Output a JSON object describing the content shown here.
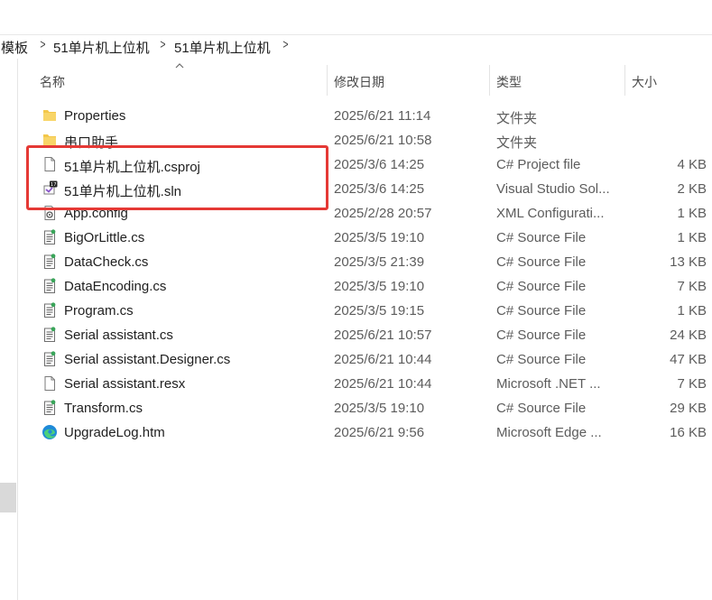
{
  "breadcrumb": {
    "items": [
      "模板",
      "51单片机上位机",
      "51单片机上位机"
    ]
  },
  "columns": {
    "name": "名称",
    "date": "修改日期",
    "type": "类型",
    "size": "大小"
  },
  "files": [
    {
      "name": "Properties",
      "date": "2025/6/21 11:14",
      "type": "文件夹",
      "size": "",
      "icon": "folder-icon"
    },
    {
      "name": "串口助手",
      "date": "2025/6/21 10:58",
      "type": "文件夹",
      "size": "",
      "icon": "folder-icon"
    },
    {
      "name": "51单片机上位机.csproj",
      "date": "2025/3/6 14:25",
      "type": "C# Project file",
      "size": "4 KB",
      "icon": "blank-file-icon"
    },
    {
      "name": "51单片机上位机.sln",
      "date": "2025/3/6 14:25",
      "type": "Visual Studio Sol...",
      "size": "2 KB",
      "icon": "visual-studio-solution-icon"
    },
    {
      "name": "App.config",
      "date": "2025/2/28 20:57",
      "type": "XML Configurati...",
      "size": "1 KB",
      "icon": "config-file-icon"
    },
    {
      "name": "BigOrLittle.cs",
      "date": "2025/3/5 19:10",
      "type": "C# Source File",
      "size": "1 KB",
      "icon": "csharp-file-icon"
    },
    {
      "name": "DataCheck.cs",
      "date": "2025/3/5 21:39",
      "type": "C# Source File",
      "size": "13 KB",
      "icon": "csharp-file-icon"
    },
    {
      "name": "DataEncoding.cs",
      "date": "2025/3/5 19:10",
      "type": "C# Source File",
      "size": "7 KB",
      "icon": "csharp-file-icon"
    },
    {
      "name": "Program.cs",
      "date": "2025/3/5 19:15",
      "type": "C# Source File",
      "size": "1 KB",
      "icon": "csharp-file-icon"
    },
    {
      "name": "Serial assistant.cs",
      "date": "2025/6/21 10:57",
      "type": "C# Source File",
      "size": "24 KB",
      "icon": "csharp-file-icon"
    },
    {
      "name": "Serial assistant.Designer.cs",
      "date": "2025/6/21 10:44",
      "type": "C# Source File",
      "size": "47 KB",
      "icon": "csharp-file-icon"
    },
    {
      "name": "Serial assistant.resx",
      "date": "2025/6/21 10:44",
      "type": "Microsoft .NET ...",
      "size": "7 KB",
      "icon": "resx-file-icon"
    },
    {
      "name": "Transform.cs",
      "date": "2025/3/5 19:10",
      "type": "C# Source File",
      "size": "29 KB",
      "icon": "csharp-file-icon"
    },
    {
      "name": "UpgradeLog.htm",
      "date": "2025/6/21 9:56",
      "type": "Microsoft Edge ...",
      "size": "16 KB",
      "icon": "edge-icon"
    }
  ],
  "colors": {
    "highlight_box": "#e53935",
    "folder": "#f3c74a"
  }
}
